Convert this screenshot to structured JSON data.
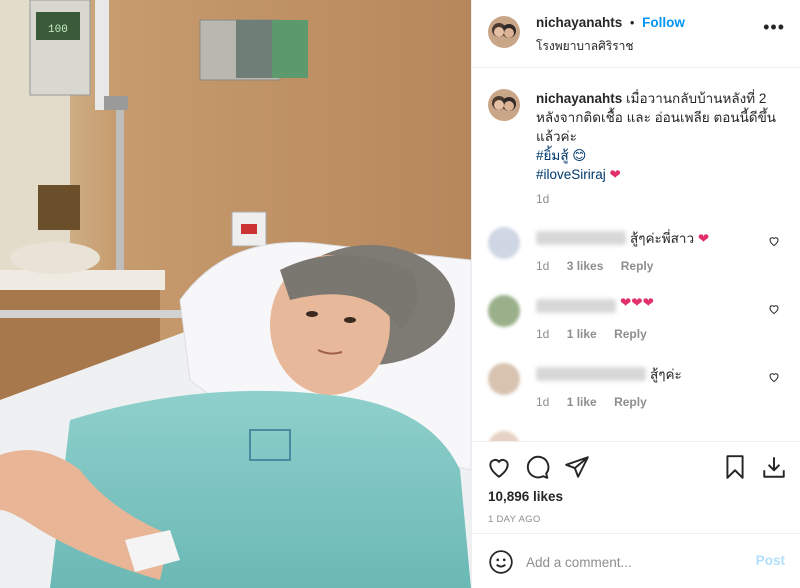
{
  "post": {
    "username": "nichayanahts",
    "follow_label": "Follow",
    "dot": "•",
    "location": "โรงพยาบาลศิริราช",
    "more_label": "•••"
  },
  "caption": {
    "username": "nichayanahts",
    "text": "เมื่อวานกลับบ้านหลังที่ 2 หลังจากติดเชื้อ และ อ่อนเพลีย ตอนนี้ดีขึ้นแล้วค่ะ",
    "hashtags": [
      "#ยิ้มสู้ 😊",
      "#iloveSiriraj"
    ],
    "heart": "❤",
    "time": "1d"
  },
  "comments": [
    {
      "text": "สู้ๆค่ะพี่สาว",
      "heart": "❤",
      "time": "1d",
      "likes": "3 likes",
      "reply": "Reply",
      "avatar_color": "#cfd6e4"
    },
    {
      "text": "",
      "heart": "❤❤❤",
      "time": "1d",
      "likes": "1 like",
      "reply": "Reply",
      "avatar_color": "#9ab08a"
    },
    {
      "text": "สู้ๆค่ะ",
      "heart": "",
      "time": "1d",
      "likes": "1 like",
      "reply": "Reply",
      "avatar_color": "#d8c2b0"
    }
  ],
  "likes_count": "10,896 likes",
  "posted_ago": "1 DAY AGO",
  "add_comment": {
    "placeholder": "Add a comment...",
    "post_label": "Post"
  },
  "monitor_reading": "100"
}
